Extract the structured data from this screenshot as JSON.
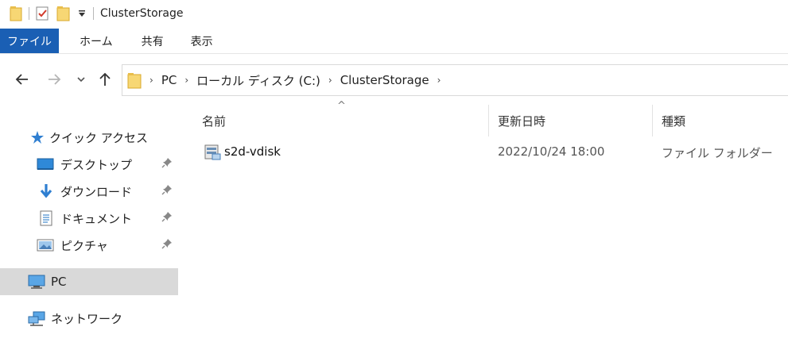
{
  "window": {
    "title": "ClusterStorage",
    "quick_access_icons": [
      "folder-icon",
      "properties-checklist-icon",
      "new-folder-icon",
      "customize-dropdown-icon"
    ]
  },
  "ribbon": {
    "tabs": [
      "ファイル",
      "ホーム",
      "共有",
      "表示"
    ],
    "active_tab_color": "#1a5fb4"
  },
  "navigation": {
    "back_icon": "back-arrow-icon",
    "forward_icon": "forward-arrow-icon",
    "recent_icon": "chevron-down-icon",
    "up_icon": "up-arrow-icon"
  },
  "address_bar": {
    "breadcrumbs": [
      "PC",
      "ローカル ディスク (C:)",
      "ClusterStorage"
    ]
  },
  "nav_pane": {
    "quick_access": "クイック アクセス",
    "pinned": [
      {
        "label": "デスクトップ",
        "icon": "desktop-icon",
        "pinned": true
      },
      {
        "label": "ダウンロード",
        "icon": "download-arrow-icon",
        "pinned": true
      },
      {
        "label": "ドキュメント",
        "icon": "document-icon",
        "pinned": true
      },
      {
        "label": "ピクチャ",
        "icon": "pictures-icon",
        "pinned": true
      }
    ],
    "pc": "PC",
    "network": "ネットワーク",
    "selected_background": "#d9d9d9"
  },
  "file_list": {
    "columns": [
      "名前",
      "更新日時",
      "種類"
    ],
    "sort_indicator": "^",
    "rows": [
      {
        "name": "s2d-vdisk",
        "modified": "2022/10/24 18:00",
        "type": "ファイル フォルダー",
        "icon": "volume-mount-folder-icon"
      }
    ]
  }
}
